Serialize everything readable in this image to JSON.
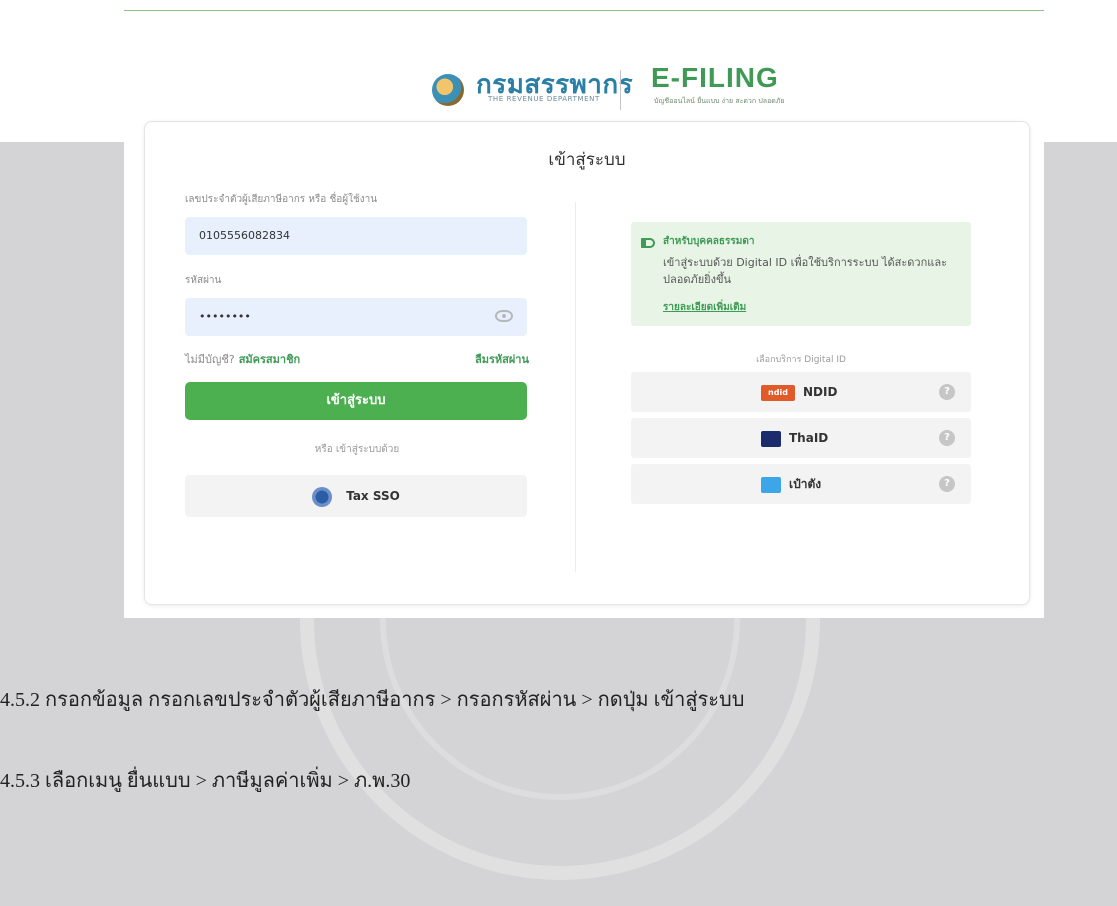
{
  "brand": {
    "department_name": "กรมสรรพากร",
    "department_sub": "THE REVENUE DEPARTMENT",
    "product_name": "E-FILING",
    "product_sub": "บัญชีออนไลน์ ยื่นแบบ ง่าย สะดวก ปลอดภัย"
  },
  "login": {
    "title": "เข้าสู่ระบบ",
    "id_label": "เลขประจำตัวผู้เสียภาษีอากร หรือ ชื่อผู้ใช้งาน",
    "id_value": "0105556082834",
    "password_label": "รหัสผ่าน",
    "password_value": "••••••••",
    "no_account_text": "ไม่มีบัญชี?",
    "register_link": "สมัครสมาชิก",
    "forgot_link": "ลืมรหัสผ่าน",
    "login_button": "เข้าสู่ระบบ",
    "or_text": "หรือ เข้าสู่ระบบด้วย",
    "sso_button": "Tax SSO"
  },
  "digital_id": {
    "info_title": "สำหรับบุคคลธรรมดา",
    "info_body": "เข้าสู่ระบบด้วย Digital ID เพื่อใช้บริการระบบ ได้สะดวกและปลอดภัยยิ่งขึ้น",
    "info_link": "รายละเอียดเพิ่มเติม",
    "choose_text": "เลือกบริการ Digital ID",
    "providers": [
      {
        "label": "NDID",
        "logo_text": "ndid"
      },
      {
        "label": "ThaID",
        "logo_text": "ThaiD"
      },
      {
        "label": "เป๋าตัง",
        "logo_text": "เป๋าตัง"
      }
    ],
    "help_glyph": "?"
  },
  "captions": {
    "step_452": "4.5.2 กรอกข้อมูล กรอกเลขประจำตัวผู้เสียภาษีอากร > กรอกรหัสผ่าน > กดปุ่ม เข้าสู่ระบบ",
    "step_453": "4.5.3 เลือกเมนู ยื่นแบบ > ภาษีมูลค่าเพิ่ม > ภ.พ.30"
  }
}
